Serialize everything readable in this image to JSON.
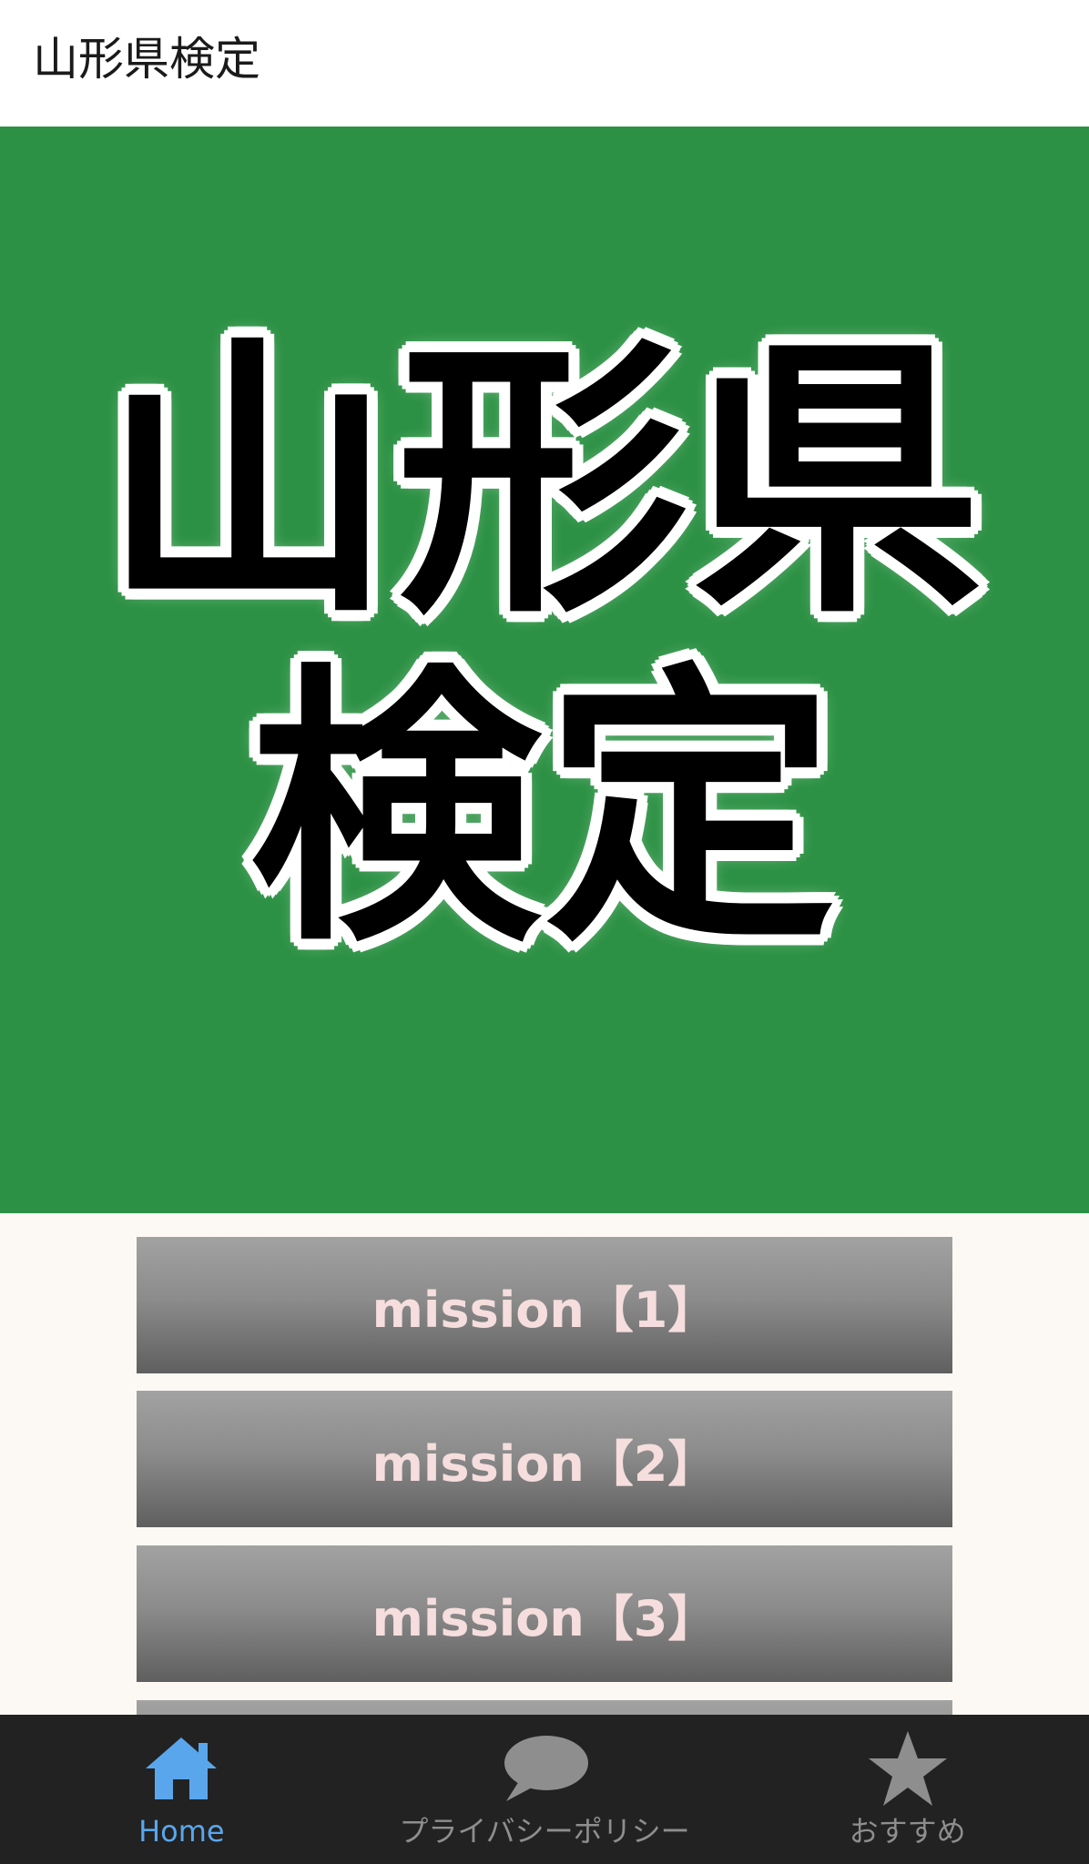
{
  "app_bar": {
    "title": "山形県検定"
  },
  "banner": {
    "lines": [
      "山形県",
      "検定"
    ],
    "background": "#2c9144"
  },
  "missions": [
    {
      "label": "mission【1】"
    },
    {
      "label": "mission【2】"
    },
    {
      "label": "mission【3】"
    }
  ],
  "bottom_nav": {
    "items": [
      {
        "label": "Home",
        "icon": "home-icon",
        "active": true,
        "color": "#5aa6ec"
      },
      {
        "label": "プライバシーポリシー",
        "icon": "chat-bubble-icon",
        "active": false,
        "color": "#8e8e8e"
      },
      {
        "label": "おすすめ",
        "icon": "star-icon",
        "active": false,
        "color": "#8e8e8e"
      }
    ]
  }
}
